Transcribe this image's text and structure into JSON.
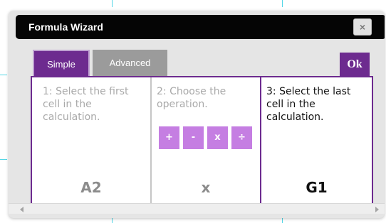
{
  "dialog": {
    "title": "Formula Wizard",
    "close_label": "×",
    "ok_label": "Ok"
  },
  "tabs": [
    {
      "label": "Simple",
      "active": true
    },
    {
      "label": "Advanced",
      "active": false
    }
  ],
  "steps": [
    {
      "text": "1: Select the first cell in the calculation.",
      "value": "A2"
    },
    {
      "text": "2: Choose the operation.",
      "value": "x"
    },
    {
      "text": "3: Select the last cell in the calculation.",
      "value": "G1"
    }
  ],
  "operations": [
    "+",
    "-",
    "x",
    "÷"
  ],
  "colors": {
    "accent": "#6d2b8f",
    "operation_button": "#c57ee2",
    "titlebar": "#050505"
  }
}
